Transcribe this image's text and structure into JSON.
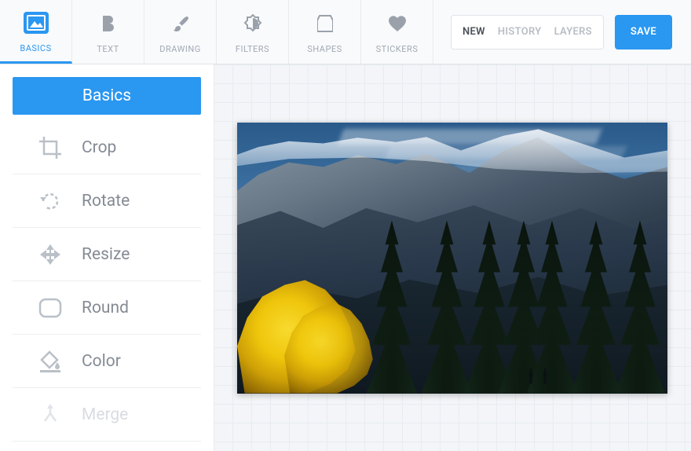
{
  "toolbar": {
    "tabs": [
      {
        "label": "BASICS",
        "icon": "image-icon",
        "active": true
      },
      {
        "label": "TEXT",
        "icon": "bold-icon",
        "active": false
      },
      {
        "label": "DRAWING",
        "icon": "brush-icon",
        "active": false
      },
      {
        "label": "FILTERS",
        "icon": "contrast-icon",
        "active": false
      },
      {
        "label": "SHAPES",
        "icon": "shape-icon",
        "active": false
      },
      {
        "label": "STICKERS",
        "icon": "heart-icon",
        "active": false
      }
    ],
    "right": {
      "new": "NEW",
      "history": "HISTORY",
      "layers": "LAYERS",
      "save": "SAVE"
    }
  },
  "sidebar": {
    "header": "Basics",
    "items": [
      {
        "label": "Crop",
        "icon": "crop-icon",
        "disabled": false
      },
      {
        "label": "Rotate",
        "icon": "rotate-icon",
        "disabled": false
      },
      {
        "label": "Resize",
        "icon": "resize-icon",
        "disabled": false
      },
      {
        "label": "Round",
        "icon": "round-rect-icon",
        "disabled": false
      },
      {
        "label": "Color",
        "icon": "fill-color-icon",
        "disabled": false
      },
      {
        "label": "Merge",
        "icon": "merge-icon",
        "disabled": true
      }
    ]
  },
  "canvas": {
    "description": "mountain landscape with snow peaks, evergreen trees, autumn foliage and two hikers"
  }
}
